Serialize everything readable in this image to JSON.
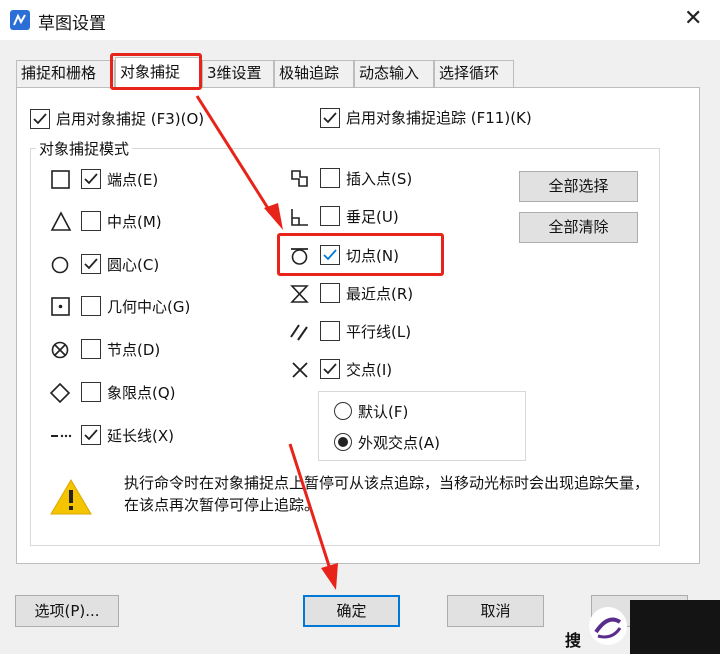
{
  "dialog": {
    "title": "草图设置",
    "close": "✕"
  },
  "tabs": [
    "捕捉和栅格",
    "对象捕捉",
    "3维设置",
    "极轴追踪",
    "动态输入",
    "选择循环"
  ],
  "top_checks": {
    "enable_snap": {
      "label": "启用对象捕捉 (F3)(O)",
      "checked": true
    },
    "enable_tracking": {
      "label": "启用对象捕捉追踪 (F11)(K)",
      "checked": true
    }
  },
  "group_label": "对象捕捉模式",
  "left_modes": [
    {
      "icon": "square-snap-icon",
      "label": "端点(E)",
      "checked": true
    },
    {
      "icon": "triangle-snap-icon",
      "label": "中点(M)",
      "checked": false
    },
    {
      "icon": "circle-snap-icon",
      "label": "圆心(C)",
      "checked": true
    },
    {
      "icon": "dotted-square-snap-icon",
      "label": "几何中心(G)",
      "checked": false
    },
    {
      "icon": "node-snap-icon",
      "label": "节点(D)",
      "checked": false
    },
    {
      "icon": "diamond-snap-icon",
      "label": "象限点(Q)",
      "checked": false
    },
    {
      "icon": "extension-snap-icon",
      "label": "延长线(X)",
      "checked": true
    }
  ],
  "right_modes": [
    {
      "icon": "insert-snap-icon",
      "label": "插入点(S)",
      "checked": false
    },
    {
      "icon": "perpendicular-snap-icon",
      "label": "垂足(U)",
      "checked": false
    },
    {
      "icon": "tangent-snap-icon",
      "label": "切点(N)",
      "checked": true
    },
    {
      "icon": "nearest-snap-icon",
      "label": "最近点(R)",
      "checked": false
    },
    {
      "icon": "parallel-snap-icon",
      "label": "平行线(L)",
      "checked": false
    },
    {
      "icon": "intersection-snap-icon",
      "label": "交点(I)",
      "checked": true
    }
  ],
  "radio_options": [
    {
      "label": "默认(F)",
      "selected": false
    },
    {
      "label": "外观交点(A)",
      "selected": true
    }
  ],
  "side_buttons": {
    "select_all": "全部选择",
    "clear_all": "全部清除"
  },
  "description": "执行命令时在对象捕捉点上暂停可从该点追踪，当移动光标时会出现追踪矢量，在该点再次暂停可停止追踪。",
  "footer": {
    "options": "选项(P)...",
    "ok": "确定",
    "cancel": "取消"
  },
  "watermark_char": "搜",
  "colors": {
    "annotation_red": "#e8231a",
    "button_border_blue": "#0078d7",
    "warning_yellow": "#f5c400"
  }
}
